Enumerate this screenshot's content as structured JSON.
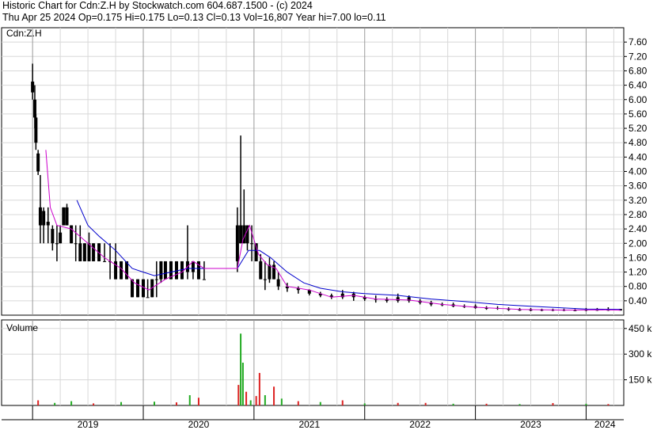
{
  "header": {
    "line1": "Historic Chart for Cdn:Z.H by Stockwatch.com 604.687.1500 - (c) 2024",
    "line2": "Thu Apr 25 2024   Op=0.175  Hi=0.175  Lo=0.13  Cl=0.13  Vol=16,807  Year hi=7.00  lo=0.11"
  },
  "colors": {
    "background": "#ffffff",
    "grid": "#d8d8d8",
    "bars": "#000000",
    "ma_short": "#cc00cc",
    "ma_long": "#0000cc",
    "vol_up": "#22aa22",
    "vol_down": "#dd2222"
  },
  "chart_data": [
    {
      "type": "line",
      "panel_label": "Cdn:Z.H",
      "ylim": [
        0,
        8.0
      ],
      "y_ticks": [
        "7.60",
        "7.20",
        "6.80",
        "6.40",
        "6.00",
        "5.60",
        "5.20",
        "4.80",
        "4.40",
        "4.00",
        "3.60",
        "3.20",
        "2.80",
        "2.40",
        "2.00",
        "1.60",
        "1.20",
        "0.80",
        "0.40"
      ],
      "x_ticks": [
        "2019",
        "2020",
        "2021",
        "2022",
        "2023",
        "2024"
      ],
      "price_bars": [
        {
          "t": 2019.0,
          "o": 6.5,
          "h": 7.0,
          "l": 6.0,
          "c": 6.2
        },
        {
          "t": 2019.02,
          "o": 6.0,
          "h": 6.4,
          "l": 5.2,
          "c": 5.5
        },
        {
          "t": 2019.03,
          "o": 5.5,
          "h": 5.6,
          "l": 4.6,
          "c": 4.8
        },
        {
          "t": 2019.05,
          "o": 4.5,
          "h": 4.6,
          "l": 3.9,
          "c": 4.0
        },
        {
          "t": 2019.07,
          "o": 3.0,
          "h": 3.9,
          "l": 2.0,
          "c": 2.5
        },
        {
          "t": 2019.1,
          "o": 2.9,
          "h": 3.0,
          "l": 2.0,
          "c": 2.5
        },
        {
          "t": 2019.14,
          "o": 2.5,
          "h": 3.0,
          "l": 2.0,
          "c": 2.6
        },
        {
          "t": 2019.18,
          "o": 2.4,
          "h": 2.5,
          "l": 1.8,
          "c": 2.0
        },
        {
          "t": 2019.22,
          "o": 2.0,
          "h": 2.5,
          "l": 1.5,
          "c": 2.0
        },
        {
          "t": 2019.25,
          "o": 2.0,
          "h": 2.5,
          "l": 2.0,
          "c": 2.3
        },
        {
          "t": 2019.28,
          "o": 2.5,
          "h": 3.0,
          "l": 2.5,
          "c": 3.0
        },
        {
          "t": 2019.31,
          "o": 3.0,
          "h": 3.1,
          "l": 2.5,
          "c": 2.5
        },
        {
          "t": 2019.35,
          "o": 2.5,
          "h": 2.5,
          "l": 2.0,
          "c": 2.0
        },
        {
          "t": 2019.39,
          "o": 2.0,
          "h": 2.5,
          "l": 1.5,
          "c": 2.0
        },
        {
          "t": 2019.43,
          "o": 2.0,
          "h": 2.5,
          "l": 1.5,
          "c": 1.5
        },
        {
          "t": 2019.47,
          "o": 1.5,
          "h": 2.0,
          "l": 1.5,
          "c": 2.0
        },
        {
          "t": 2019.51,
          "o": 2.0,
          "h": 2.3,
          "l": 1.5,
          "c": 1.5
        },
        {
          "t": 2019.55,
          "o": 1.5,
          "h": 2.0,
          "l": 1.5,
          "c": 2.0
        },
        {
          "t": 2019.6,
          "o": 2.0,
          "h": 2.0,
          "l": 1.5,
          "c": 1.5
        },
        {
          "t": 2019.65,
          "o": 1.5,
          "h": 2.0,
          "l": 1.5,
          "c": 1.5
        },
        {
          "t": 2019.7,
          "o": 1.5,
          "h": 2.0,
          "l": 1.0,
          "c": 1.5
        },
        {
          "t": 2019.75,
          "o": 1.5,
          "h": 2.0,
          "l": 1.0,
          "c": 1.0
        },
        {
          "t": 2019.8,
          "o": 1.0,
          "h": 1.5,
          "l": 1.0,
          "c": 1.5
        },
        {
          "t": 2019.85,
          "o": 1.5,
          "h": 1.5,
          "l": 1.0,
          "c": 1.0
        },
        {
          "t": 2019.9,
          "o": 1.0,
          "h": 1.0,
          "l": 0.5,
          "c": 0.5
        },
        {
          "t": 2019.95,
          "o": 0.5,
          "h": 1.0,
          "l": 0.5,
          "c": 1.0
        },
        {
          "t": 2020.0,
          "o": 1.0,
          "h": 1.0,
          "l": 0.5,
          "c": 0.5
        },
        {
          "t": 2020.04,
          "o": 0.5,
          "h": 1.0,
          "l": 0.5,
          "c": 0.5
        },
        {
          "t": 2020.08,
          "o": 0.5,
          "h": 1.0,
          "l": 0.5,
          "c": 1.0
        },
        {
          "t": 2020.12,
          "o": 1.0,
          "h": 1.5,
          "l": 0.5,
          "c": 1.0
        },
        {
          "t": 2020.16,
          "o": 1.0,
          "h": 1.5,
          "l": 0.9,
          "c": 1.5
        },
        {
          "t": 2020.2,
          "o": 1.5,
          "h": 1.5,
          "l": 1.0,
          "c": 1.0
        },
        {
          "t": 2020.25,
          "o": 1.0,
          "h": 1.5,
          "l": 1.0,
          "c": 1.5
        },
        {
          "t": 2020.3,
          "o": 1.5,
          "h": 1.5,
          "l": 1.0,
          "c": 1.0
        },
        {
          "t": 2020.35,
          "o": 1.0,
          "h": 1.5,
          "l": 1.0,
          "c": 1.5
        },
        {
          "t": 2020.4,
          "o": 1.5,
          "h": 2.5,
          "l": 1.0,
          "c": 1.2
        },
        {
          "t": 2020.45,
          "o": 1.2,
          "h": 1.5,
          "l": 1.0,
          "c": 1.5
        },
        {
          "t": 2020.5,
          "o": 1.5,
          "h": 1.5,
          "l": 1.0,
          "c": 1.0
        },
        {
          "t": 2020.55,
          "o": 1.0,
          "h": 1.5,
          "l": 1.0,
          "c": 1.0
        },
        {
          "t": 2020.85,
          "o": 1.5,
          "h": 3.0,
          "l": 1.2,
          "c": 2.5
        },
        {
          "t": 2020.88,
          "o": 2.5,
          "h": 5.0,
          "l": 2.0,
          "c": 2.0
        },
        {
          "t": 2020.91,
          "o": 2.0,
          "h": 3.5,
          "l": 2.0,
          "c": 2.5
        },
        {
          "t": 2020.94,
          "o": 2.5,
          "h": 2.5,
          "l": 1.8,
          "c": 2.0
        },
        {
          "t": 2020.98,
          "o": 2.0,
          "h": 2.5,
          "l": 1.5,
          "c": 2.0
        },
        {
          "t": 2021.02,
          "o": 2.0,
          "h": 2.0,
          "l": 1.5,
          "c": 1.5
        },
        {
          "t": 2021.06,
          "o": 1.5,
          "h": 1.7,
          "l": 1.0,
          "c": 1.0
        },
        {
          "t": 2021.1,
          "o": 1.0,
          "h": 1.5,
          "l": 0.7,
          "c": 1.0
        },
        {
          "t": 2021.14,
          "o": 1.0,
          "h": 1.6,
          "l": 0.9,
          "c": 1.4
        },
        {
          "t": 2021.18,
          "o": 1.4,
          "h": 1.5,
          "l": 1.0,
          "c": 1.0
        },
        {
          "t": 2021.22,
          "o": 1.0,
          "h": 1.2,
          "l": 0.7,
          "c": 0.8
        },
        {
          "t": 2021.3,
          "o": 0.8,
          "h": 0.9,
          "l": 0.65,
          "c": 0.75
        },
        {
          "t": 2021.4,
          "o": 0.75,
          "h": 0.8,
          "l": 0.6,
          "c": 0.7
        },
        {
          "t": 2021.5,
          "o": 0.7,
          "h": 0.72,
          "l": 0.55,
          "c": 0.6
        },
        {
          "t": 2021.6,
          "o": 0.6,
          "h": 0.65,
          "l": 0.5,
          "c": 0.55
        },
        {
          "t": 2021.7,
          "o": 0.55,
          "h": 0.6,
          "l": 0.45,
          "c": 0.5
        },
        {
          "t": 2021.8,
          "o": 0.5,
          "h": 0.7,
          "l": 0.45,
          "c": 0.6
        },
        {
          "t": 2021.9,
          "o": 0.6,
          "h": 0.65,
          "l": 0.4,
          "c": 0.5
        },
        {
          "t": 2022.0,
          "o": 0.5,
          "h": 0.55,
          "l": 0.4,
          "c": 0.45
        },
        {
          "t": 2022.1,
          "o": 0.45,
          "h": 0.55,
          "l": 0.35,
          "c": 0.45
        },
        {
          "t": 2022.2,
          "o": 0.45,
          "h": 0.5,
          "l": 0.35,
          "c": 0.4
        },
        {
          "t": 2022.3,
          "o": 0.4,
          "h": 0.6,
          "l": 0.35,
          "c": 0.5
        },
        {
          "t": 2022.4,
          "o": 0.5,
          "h": 0.55,
          "l": 0.35,
          "c": 0.4
        },
        {
          "t": 2022.5,
          "o": 0.4,
          "h": 0.45,
          "l": 0.3,
          "c": 0.35
        },
        {
          "t": 2022.6,
          "o": 0.35,
          "h": 0.4,
          "l": 0.25,
          "c": 0.3
        },
        {
          "t": 2022.7,
          "o": 0.3,
          "h": 0.35,
          "l": 0.25,
          "c": 0.3
        },
        {
          "t": 2022.8,
          "o": 0.3,
          "h": 0.35,
          "l": 0.22,
          "c": 0.25
        },
        {
          "t": 2022.9,
          "o": 0.25,
          "h": 0.3,
          "l": 0.2,
          "c": 0.25
        },
        {
          "t": 2023.0,
          "o": 0.25,
          "h": 0.3,
          "l": 0.18,
          "c": 0.2
        },
        {
          "t": 2023.1,
          "o": 0.2,
          "h": 0.25,
          "l": 0.15,
          "c": 0.2
        },
        {
          "t": 2023.2,
          "o": 0.2,
          "h": 0.25,
          "l": 0.15,
          "c": 0.18
        },
        {
          "t": 2023.3,
          "o": 0.18,
          "h": 0.22,
          "l": 0.12,
          "c": 0.15
        },
        {
          "t": 2023.4,
          "o": 0.15,
          "h": 0.2,
          "l": 0.12,
          "c": 0.15
        },
        {
          "t": 2023.5,
          "o": 0.15,
          "h": 0.2,
          "l": 0.11,
          "c": 0.15
        },
        {
          "t": 2023.6,
          "o": 0.15,
          "h": 0.18,
          "l": 0.11,
          "c": 0.14
        },
        {
          "t": 2023.7,
          "o": 0.14,
          "h": 0.18,
          "l": 0.11,
          "c": 0.15
        },
        {
          "t": 2023.8,
          "o": 0.15,
          "h": 0.18,
          "l": 0.11,
          "c": 0.14
        },
        {
          "t": 2023.9,
          "o": 0.14,
          "h": 0.17,
          "l": 0.11,
          "c": 0.13
        },
        {
          "t": 2024.0,
          "o": 0.13,
          "h": 0.2,
          "l": 0.11,
          "c": 0.15
        },
        {
          "t": 2024.1,
          "o": 0.15,
          "h": 0.2,
          "l": 0.12,
          "c": 0.14
        },
        {
          "t": 2024.2,
          "o": 0.14,
          "h": 0.22,
          "l": 0.12,
          "c": 0.15
        },
        {
          "t": 2024.31,
          "o": 0.175,
          "h": 0.175,
          "l": 0.13,
          "c": 0.13
        }
      ],
      "ma_short": [
        [
          2019.12,
          4.6
        ],
        [
          2019.16,
          3.0
        ],
        [
          2019.22,
          2.5
        ],
        [
          2019.35,
          2.4
        ],
        [
          2019.5,
          2.0
        ],
        [
          2019.65,
          1.6
        ],
        [
          2019.8,
          1.3
        ],
        [
          2019.92,
          0.9
        ],
        [
          2020.05,
          0.7
        ],
        [
          2020.2,
          1.0
        ],
        [
          2020.35,
          1.2
        ],
        [
          2020.45,
          1.5
        ],
        [
          2020.55,
          1.3
        ],
        [
          2020.85,
          1.3
        ],
        [
          2020.9,
          2.1
        ],
        [
          2020.96,
          2.5
        ],
        [
          2021.04,
          1.7
        ],
        [
          2021.12,
          1.4
        ],
        [
          2021.2,
          1.3
        ],
        [
          2021.3,
          0.8
        ],
        [
          2021.5,
          0.7
        ],
        [
          2021.7,
          0.5
        ],
        [
          2021.9,
          0.55
        ],
        [
          2022.1,
          0.45
        ],
        [
          2022.4,
          0.42
        ],
        [
          2022.7,
          0.3
        ],
        [
          2023.0,
          0.22
        ],
        [
          2023.4,
          0.16
        ],
        [
          2023.8,
          0.14
        ],
        [
          2024.1,
          0.15
        ],
        [
          2024.31,
          0.14
        ]
      ],
      "ma_long": [
        [
          2019.4,
          3.2
        ],
        [
          2019.5,
          2.5
        ],
        [
          2019.6,
          2.2
        ],
        [
          2019.75,
          1.8
        ],
        [
          2019.9,
          1.3
        ],
        [
          2020.0,
          1.2
        ],
        [
          2020.1,
          1.1
        ],
        [
          2020.25,
          1.2
        ],
        [
          2020.4,
          1.3
        ],
        [
          2020.55,
          1.3
        ],
        [
          2020.85,
          1.3
        ],
        [
          2020.95,
          1.8
        ],
        [
          2021.05,
          1.8
        ],
        [
          2021.15,
          1.6
        ],
        [
          2021.3,
          1.2
        ],
        [
          2021.45,
          0.9
        ],
        [
          2021.6,
          0.75
        ],
        [
          2021.8,
          0.65
        ],
        [
          2022.0,
          0.6
        ],
        [
          2022.3,
          0.55
        ],
        [
          2022.6,
          0.45
        ],
        [
          2022.9,
          0.38
        ],
        [
          2023.2,
          0.3
        ],
        [
          2023.5,
          0.25
        ],
        [
          2023.8,
          0.2
        ],
        [
          2024.0,
          0.17
        ],
        [
          2024.31,
          0.16
        ]
      ]
    },
    {
      "type": "bar",
      "panel_label": "Volume",
      "ylim": [
        0,
        500
      ],
      "y_unit": "k",
      "y_ticks": [
        "450 k",
        "300 k",
        "150 k"
      ],
      "volume": [
        {
          "t": 2019.05,
          "v": 30,
          "up": false
        },
        {
          "t": 2019.2,
          "v": 15,
          "up": true
        },
        {
          "t": 2019.35,
          "v": 25,
          "up": true
        },
        {
          "t": 2019.55,
          "v": 12,
          "up": false
        },
        {
          "t": 2019.8,
          "v": 20,
          "up": true
        },
        {
          "t": 2020.1,
          "v": 22,
          "up": true
        },
        {
          "t": 2020.3,
          "v": 18,
          "up": false
        },
        {
          "t": 2020.42,
          "v": 60,
          "up": true
        },
        {
          "t": 2020.5,
          "v": 45,
          "up": false
        },
        {
          "t": 2020.86,
          "v": 120,
          "up": false
        },
        {
          "t": 2020.88,
          "v": 420,
          "up": true
        },
        {
          "t": 2020.9,
          "v": 250,
          "up": true
        },
        {
          "t": 2020.93,
          "v": 80,
          "up": false
        },
        {
          "t": 2020.97,
          "v": 30,
          "up": true
        },
        {
          "t": 2021.02,
          "v": 55,
          "up": false
        },
        {
          "t": 2021.05,
          "v": 190,
          "up": false
        },
        {
          "t": 2021.1,
          "v": 60,
          "up": true
        },
        {
          "t": 2021.18,
          "v": 110,
          "up": false
        },
        {
          "t": 2021.25,
          "v": 40,
          "up": true
        },
        {
          "t": 2021.4,
          "v": 25,
          "up": false
        },
        {
          "t": 2021.6,
          "v": 20,
          "up": true
        },
        {
          "t": 2021.8,
          "v": 30,
          "up": false
        },
        {
          "t": 2022.0,
          "v": 12,
          "up": true
        },
        {
          "t": 2022.3,
          "v": 15,
          "up": false
        },
        {
          "t": 2022.55,
          "v": 15,
          "up": false
        },
        {
          "t": 2022.8,
          "v": 10,
          "up": true
        },
        {
          "t": 2023.1,
          "v": 10,
          "up": false
        },
        {
          "t": 2023.4,
          "v": 8,
          "up": true
        },
        {
          "t": 2023.7,
          "v": 14,
          "up": false
        },
        {
          "t": 2024.0,
          "v": 10,
          "up": true
        },
        {
          "t": 2024.2,
          "v": 8,
          "up": false
        }
      ]
    }
  ]
}
